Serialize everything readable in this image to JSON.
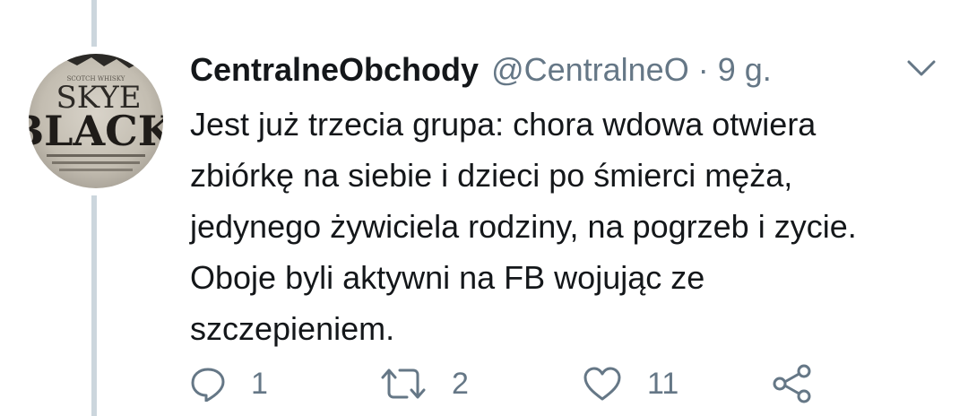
{
  "tweet": {
    "display_name": "CentralneObchody",
    "handle": "@CentralneO",
    "separator": "·",
    "time": "9 g.",
    "text_lines": [
      "Jest już trzecia grupa: chora wdowa otwiera",
      "zbiórkę na siebie i dzieci po śmierci męża,",
      "jedynego żywiciela rodziny, na pogrzeb i zycie.",
      "Oboje byli aktywni na FB wojując ze",
      "szczepieniem."
    ],
    "avatar": {
      "line1": "SKYE",
      "line2": "BLACK"
    }
  },
  "actions": {
    "reply": {
      "icon": "reply-icon",
      "count": "1"
    },
    "retweet": {
      "icon": "retweet-icon",
      "count": "2"
    },
    "like": {
      "icon": "heart-icon",
      "count": "11"
    },
    "share": {
      "icon": "share-icon"
    }
  },
  "colors": {
    "text": "#14171a",
    "secondary": "#657786",
    "thread_line": "#ccd6dd",
    "background": "#ffffff"
  }
}
